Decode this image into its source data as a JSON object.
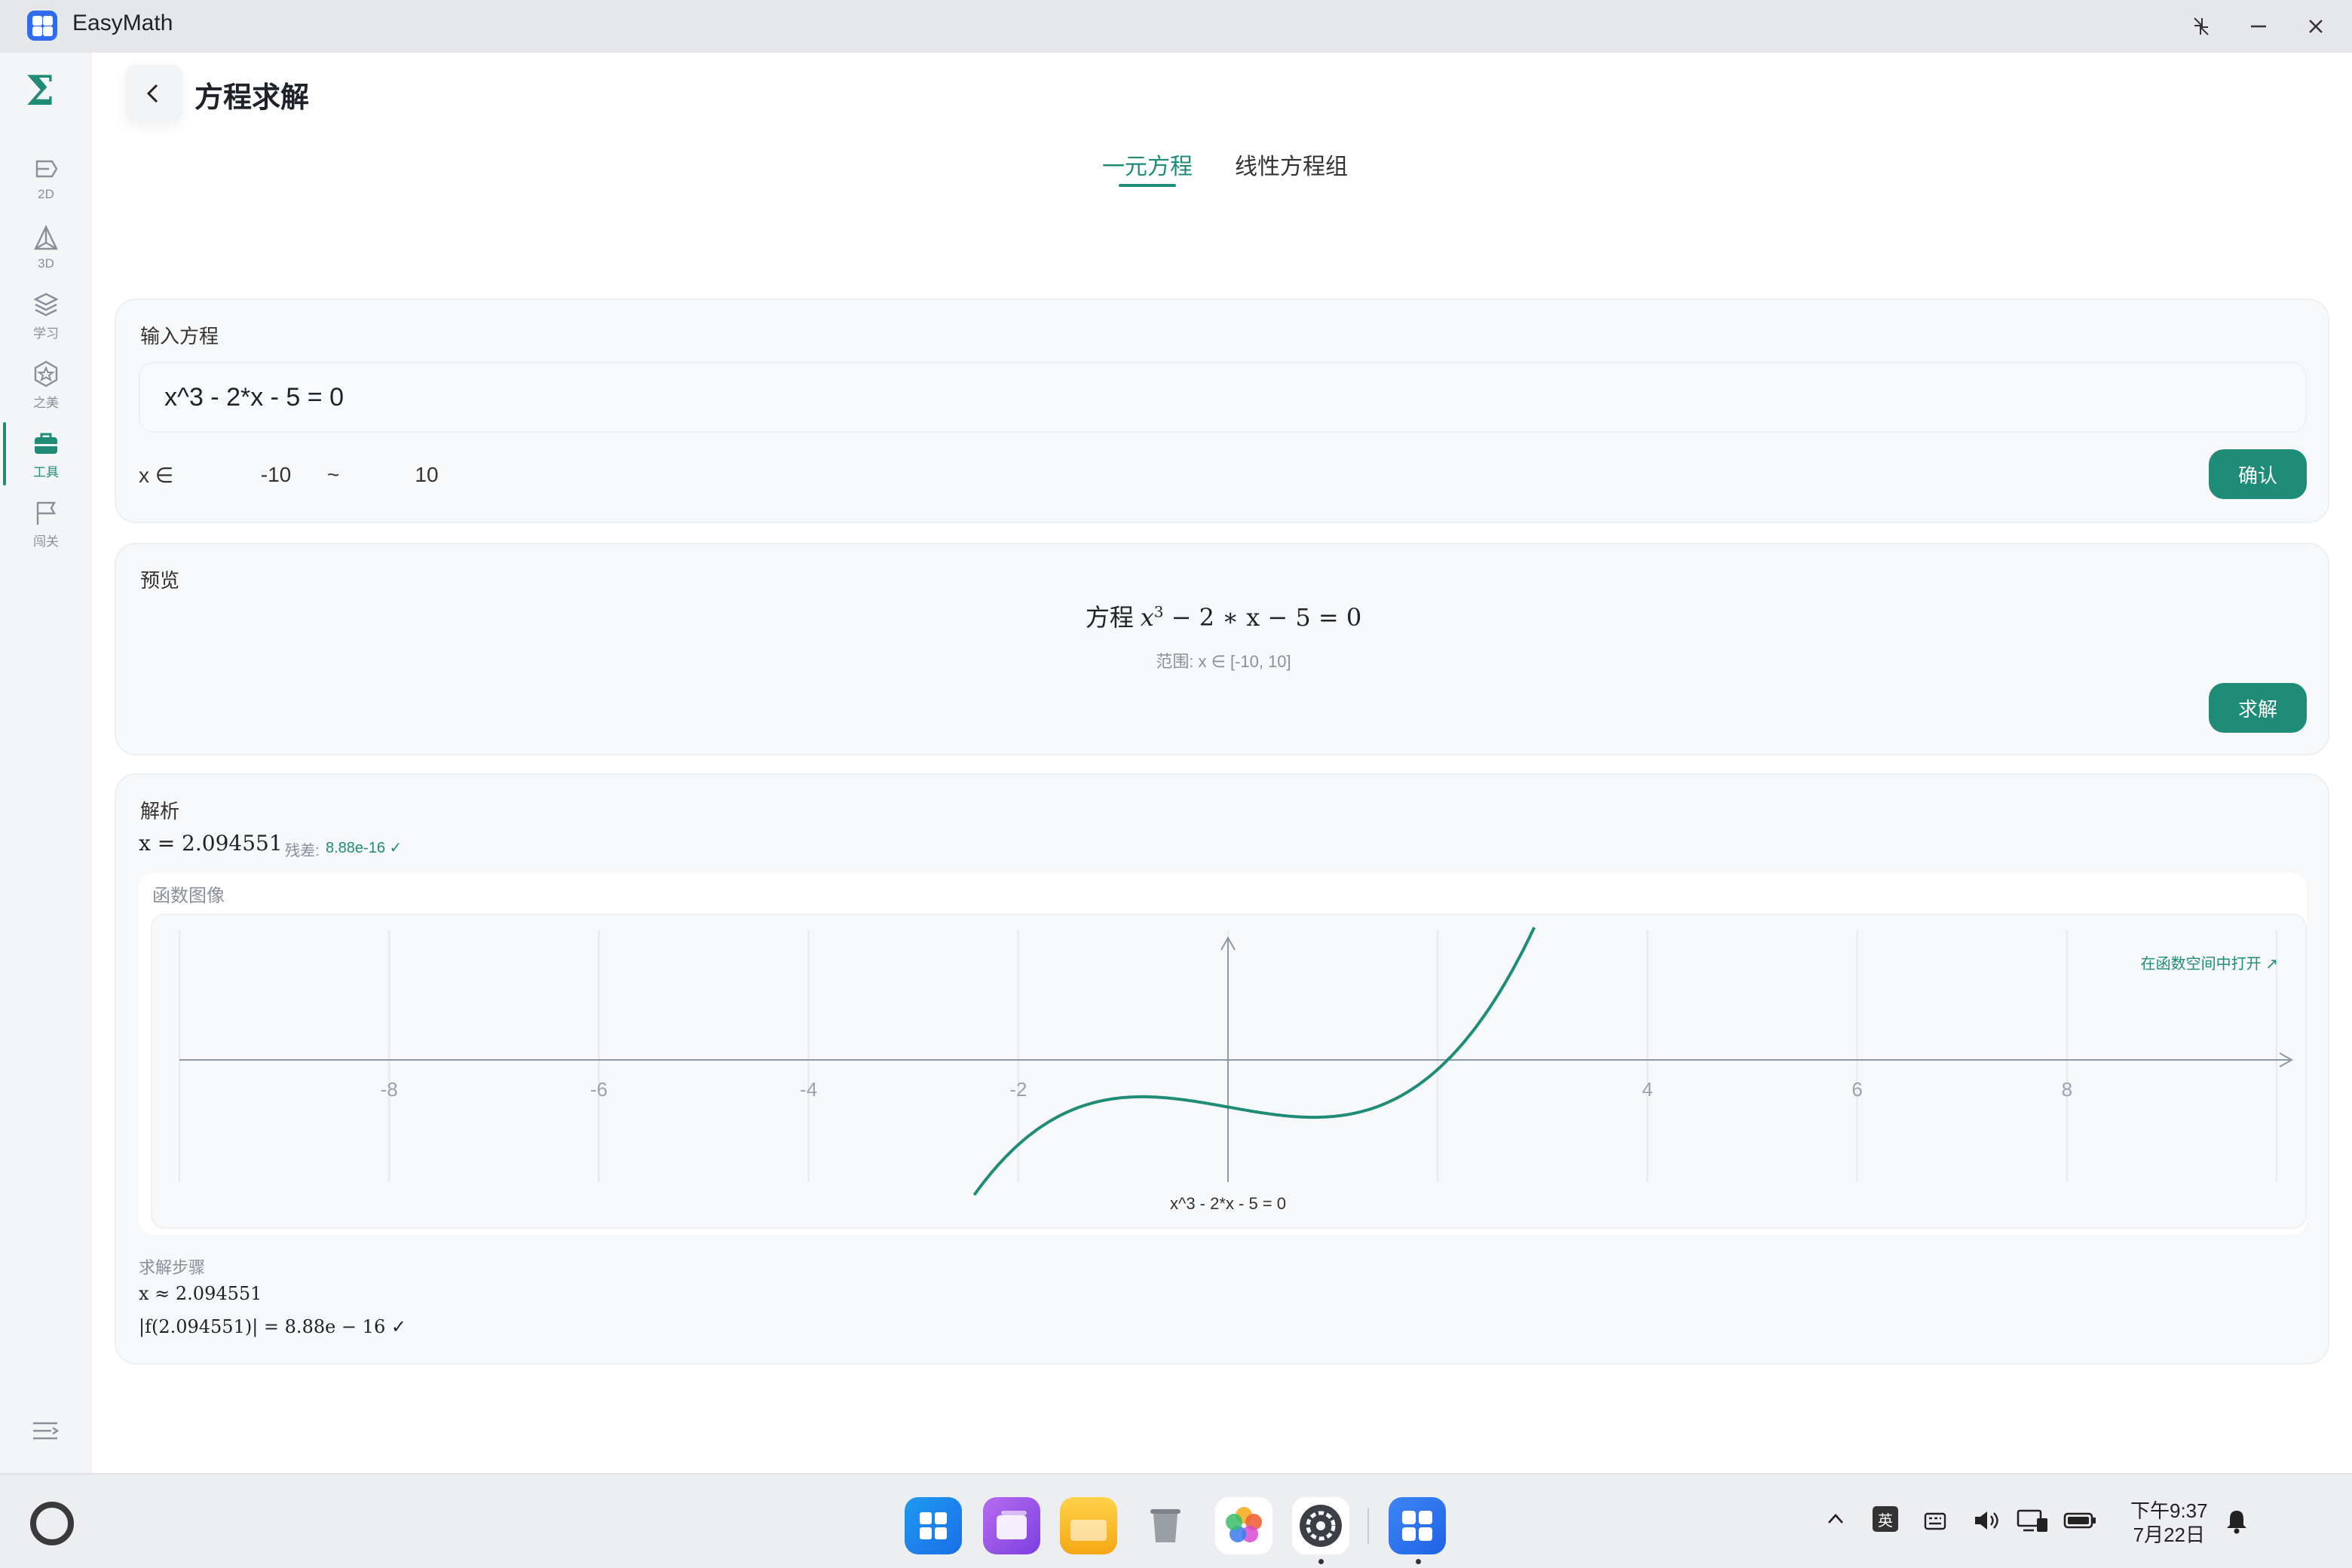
{
  "app": {
    "title": "EasyMath"
  },
  "sidebar": {
    "logo": "Σ",
    "items": [
      {
        "label": "2D"
      },
      {
        "label": "3D"
      },
      {
        "label": "学习"
      },
      {
        "label": "之美"
      },
      {
        "label": "工具"
      },
      {
        "label": "闯关"
      }
    ],
    "active_index": 4
  },
  "header": {
    "title": "方程求解"
  },
  "tabs": [
    {
      "label": "一元方程",
      "active": true
    },
    {
      "label": "线性方程组",
      "active": false
    }
  ],
  "input_card": {
    "label": "输入方程",
    "equation": "x^3 - 2*x - 5 = 0",
    "range_prefix": "x ∈",
    "range_min": "-10",
    "range_sep": "~",
    "range_max": "10",
    "confirm_label": "确认"
  },
  "preview_card": {
    "label": "预览",
    "eq_prefix": "方程",
    "eq_math_a": "x",
    "eq_math_sup": "3",
    "eq_math_b": " − 2 ∗ x − 5 = 0",
    "range_text": "范围: x ∈ [-10, 10]",
    "solve_label": "求解"
  },
  "analysis_card": {
    "label": "解析",
    "result": "x = 2.094551",
    "residual_label": "残差:",
    "residual_value": "8.88e-16 ✓",
    "graph_title": "函数图像",
    "open_link": "在函数空间中打开 ↗",
    "graph_caption": "x^3 - 2*x - 5 = 0",
    "steps_label": "求解步骤",
    "steps": [
      "x ≈ 2.094551",
      "|f(2.094551)| = 8.88e − 16 ✓"
    ]
  },
  "chart_data": {
    "type": "line",
    "x_ticks": [
      "-8",
      "-6",
      "-4",
      "-2",
      "4",
      "6",
      "8"
    ],
    "xlim": [
      -10,
      10
    ],
    "function": "x^3 - 2*x - 5",
    "root": 2.094551,
    "caption": "x^3 - 2*x - 5 = 0"
  },
  "taskbar": {
    "tray_lang": "英",
    "clock_time": "下午9:37",
    "clock_date": "7月22日"
  },
  "colors": {
    "accent": "#1e8c77",
    "sidebar_bg": "#f4f5f7",
    "card_bg": "#f6f8fa"
  }
}
